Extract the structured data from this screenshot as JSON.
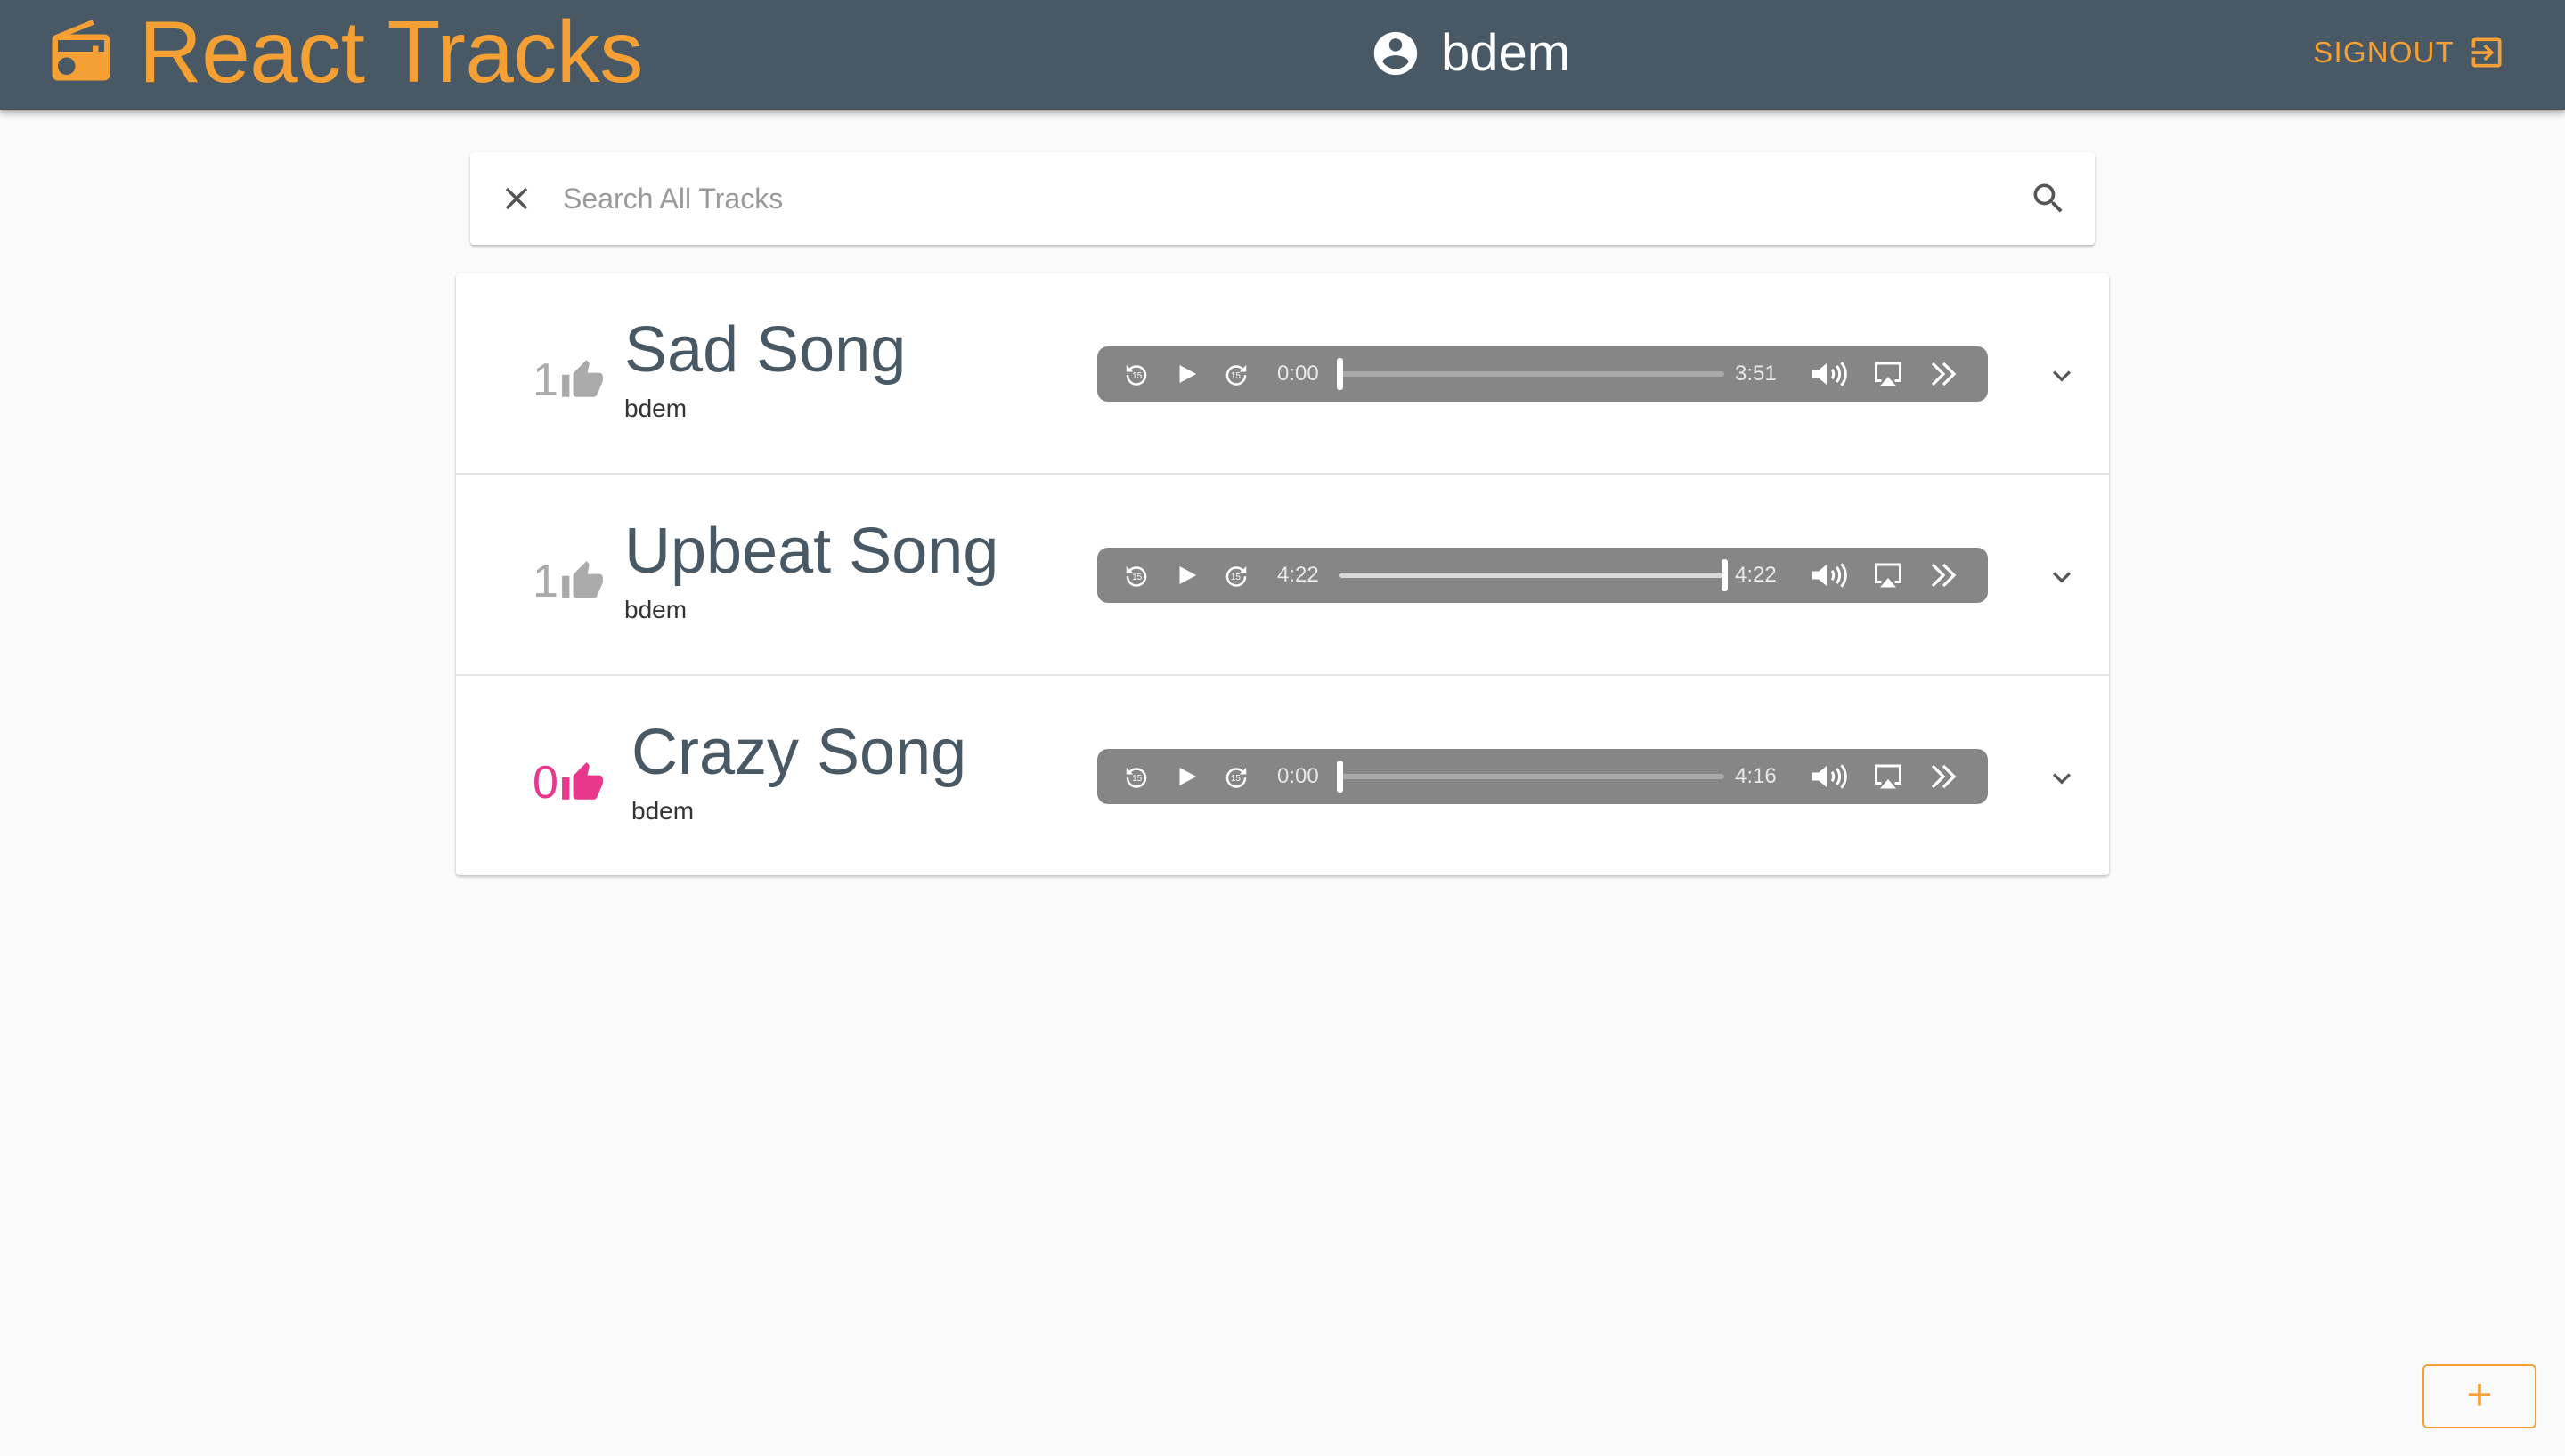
{
  "app": {
    "title": "React Tracks",
    "user": "bdem",
    "signout_label": "SIGNOUT"
  },
  "search": {
    "placeholder": "Search All Tracks",
    "value": ""
  },
  "tracks": [
    {
      "title": "Sad Song",
      "user": "bdem",
      "likes": "1",
      "liked": false,
      "current_time": "0:00",
      "duration": "3:51",
      "progress": 0
    },
    {
      "title": "Upbeat Song",
      "user": "bdem",
      "likes": "1",
      "liked": false,
      "current_time": "4:22",
      "duration": "4:22",
      "progress": 1
    },
    {
      "title": "Crazy Song",
      "user": "bdem",
      "likes": "0",
      "liked": true,
      "current_time": "0:00",
      "duration": "4:16",
      "progress": 0
    }
  ],
  "fab": {
    "label": "+"
  },
  "icons": {
    "brand": "radio-icon",
    "user": "account-circle-icon",
    "signout": "exit-to-app-icon",
    "clear": "close-icon",
    "search": "search-icon",
    "like": "thumb-up-icon",
    "rewind": "replay-15-icon",
    "play": "play-icon",
    "forward": "forward-15-icon",
    "volume": "volume-icon",
    "airplay": "airplay-icon",
    "more": "double-chevron-right-icon",
    "expand": "expand-more-icon"
  },
  "colors": {
    "appbar": "#485865",
    "accent": "#f5a034",
    "liked": "#e8378c",
    "unliked": "#aaaaaa",
    "player": "#868686"
  }
}
